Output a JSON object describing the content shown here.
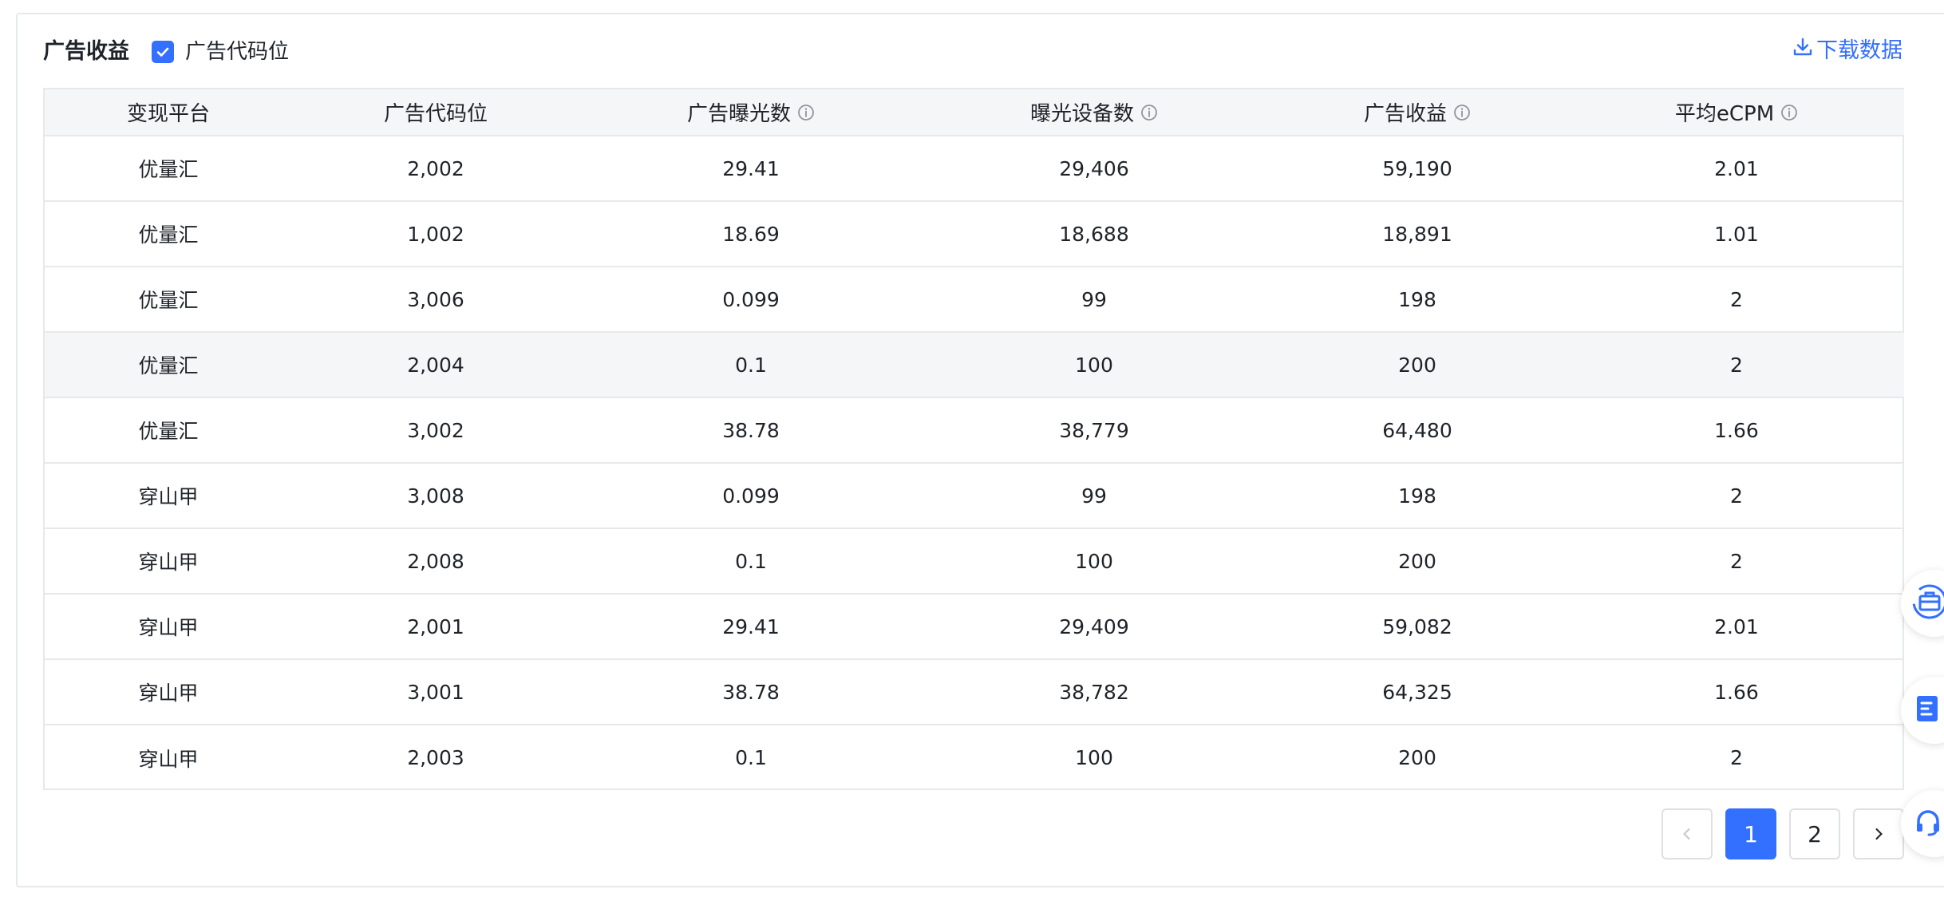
{
  "section": {
    "title": "广告收益",
    "checkbox_label": "广告代码位",
    "checkbox_checked": true,
    "download_label": "下载数据"
  },
  "table": {
    "columns": [
      {
        "label": "变现平台",
        "info": false
      },
      {
        "label": "广告代码位",
        "info": false
      },
      {
        "label": "广告曝光数",
        "info": true
      },
      {
        "label": "曝光设备数",
        "info": true
      },
      {
        "label": "广告收益",
        "info": true
      },
      {
        "label": "平均eCPM",
        "info": true
      }
    ],
    "rows": [
      [
        "优量汇",
        "2,002",
        "29.41",
        "29,406",
        "59,190",
        "2.01"
      ],
      [
        "优量汇",
        "1,002",
        "18.69",
        "18,688",
        "18,891",
        "1.01"
      ],
      [
        "优量汇",
        "3,006",
        "0.099",
        "99",
        "198",
        "2"
      ],
      [
        "优量汇",
        "2,004",
        "0.1",
        "100",
        "200",
        "2"
      ],
      [
        "优量汇",
        "3,002",
        "38.78",
        "38,779",
        "64,480",
        "1.66"
      ],
      [
        "穿山甲",
        "3,008",
        "0.099",
        "99",
        "198",
        "2"
      ],
      [
        "穿山甲",
        "2,008",
        "0.1",
        "100",
        "200",
        "2"
      ],
      [
        "穿山甲",
        "2,001",
        "29.41",
        "29,409",
        "59,082",
        "2.01"
      ],
      [
        "穿山甲",
        "3,001",
        "38.78",
        "38,782",
        "64,325",
        "1.66"
      ],
      [
        "穿山甲",
        "2,003",
        "0.1",
        "100",
        "200",
        "2"
      ]
    ],
    "highlighted_row": 3
  },
  "pagination": {
    "prev_icon": "chevron-left-icon",
    "next_icon": "chevron-right-icon",
    "pages": [
      "1",
      "2"
    ],
    "current": "1"
  },
  "floating_buttons": [
    "toolbox-icon",
    "document-icon",
    "headset-icon"
  ],
  "colors": {
    "accent": "#3370ff",
    "border": "#e6e8eb",
    "header_bg": "#f5f6f7",
    "text": "#1f2329"
  }
}
